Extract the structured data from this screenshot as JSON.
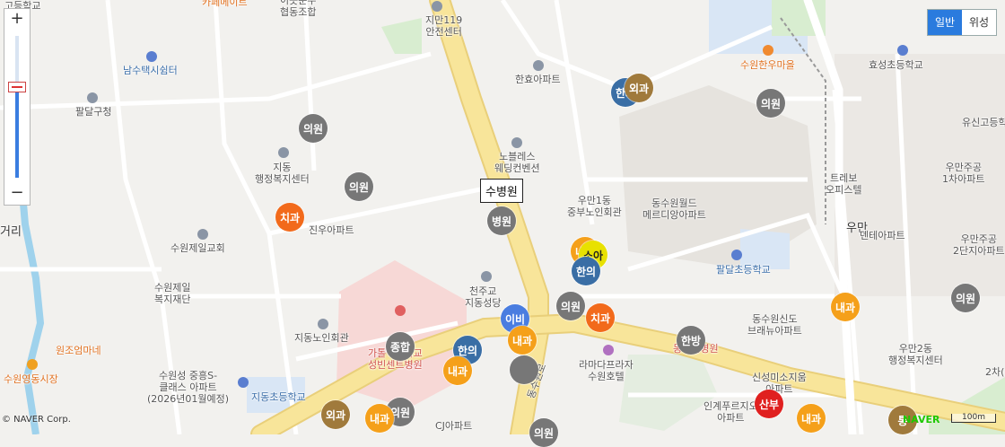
{
  "map_type": {
    "normal": "일반",
    "satellite": "위성",
    "selected": "일반"
  },
  "zoom": {
    "in": "+",
    "out": "−",
    "level_fraction": 0.64
  },
  "tooltip": "수병원",
  "copyright": "© NAVER Corp.",
  "brand": "NAVER",
  "scale_label": "100m",
  "place_labels": [
    {
      "text": "고등학교",
      "style": "normal"
    },
    {
      "text": "카페메이트",
      "style": "orange"
    },
    {
      "text": "이곳운수\n협동조합",
      "style": "normal"
    },
    {
      "text": "지만119\n안전센터",
      "style": "normal"
    },
    {
      "text": "남수택시쉼터",
      "style": "blue"
    },
    {
      "text": "팔달구청",
      "style": "normal"
    },
    {
      "text": "한효아파트",
      "style": "normal"
    },
    {
      "text": "수원한우마을",
      "style": "orange"
    },
    {
      "text": "효성초등학교",
      "style": "normal"
    },
    {
      "text": "유신고등학",
      "style": "normal"
    },
    {
      "text": "노블레스\n웨딩컨벤션",
      "style": "normal"
    },
    {
      "text": "지동\n행정복지센터",
      "style": "normal"
    },
    {
      "text": "우만1동\n중부노인회관",
      "style": "normal"
    },
    {
      "text": "동수원월드\n메르디앙아파트",
      "style": "normal"
    },
    {
      "text": "트레보\n오피스텔",
      "style": "normal"
    },
    {
      "text": "우만주공\n1차아파트",
      "style": "normal"
    },
    {
      "text": "진우아파트",
      "style": "normal"
    },
    {
      "text": "수원제일교회",
      "style": "normal"
    },
    {
      "text": "거리",
      "style": "big"
    },
    {
      "text": "우만",
      "style": "big"
    },
    {
      "text": "덴테아파트",
      "style": "normal"
    },
    {
      "text": "우만주공\n2단지아파트",
      "style": "normal"
    },
    {
      "text": "수원제일\n복지재단",
      "style": "normal"
    },
    {
      "text": "팔달초등학교",
      "style": "blue"
    },
    {
      "text": "천주교\n지동성당",
      "style": "normal"
    },
    {
      "text": "지동노인회관",
      "style": "normal"
    },
    {
      "text": "동수원신도\n브래뉴아파트",
      "style": "normal"
    },
    {
      "text": "가톨릭대학교\n성빈센트병원",
      "style": "red"
    },
    {
      "text": "원조엄마네",
      "style": "orange"
    },
    {
      "text": "수원영동시장",
      "style": "orange"
    },
    {
      "text": "수원성 중흥S-\n클래스 아파트\n(2026년01월예정)",
      "style": "normal"
    },
    {
      "text": "지동초등학교",
      "style": "blue"
    },
    {
      "text": "라마다프라자\n수원호텔",
      "style": "normal"
    },
    {
      "text": "동수원병원",
      "style": "red"
    },
    {
      "text": "신성미소지움\n아파트",
      "style": "normal"
    },
    {
      "text": "우만2동\n행정복지센터",
      "style": "normal"
    },
    {
      "text": "인계푸르지오\n아파트",
      "style": "normal"
    },
    {
      "text": "CJ아파트",
      "style": "normal"
    },
    {
      "text": "2차(",
      "style": "normal"
    },
    {
      "text": "동수원로",
      "style": "normal"
    }
  ],
  "markers": [
    {
      "label": "의원",
      "color": "#777777"
    },
    {
      "label": "의원",
      "color": "#777777"
    },
    {
      "label": "의원",
      "color": "#777777"
    },
    {
      "label": "치과",
      "color": "#f26a1b"
    },
    {
      "label": "병원",
      "color": "#777777"
    },
    {
      "label": "한의",
      "color": "#3a6ea5"
    },
    {
      "label": "외과",
      "color": "#a07a3c"
    },
    {
      "label": "의원",
      "color": "#777777"
    },
    {
      "label": "내과",
      "color": "#f5a01a"
    },
    {
      "label": "소아",
      "color": "#e8e100"
    },
    {
      "label": "한의",
      "color": "#3a6ea5"
    },
    {
      "label": "의원",
      "color": "#777777"
    },
    {
      "label": "치과",
      "color": "#f26a1b"
    },
    {
      "label": "이비",
      "color": "#4a7de0"
    },
    {
      "label": "내과",
      "color": "#f5a01a"
    },
    {
      "label": "종합",
      "color": "#777777"
    },
    {
      "label": "한의",
      "color": "#3a6ea5"
    },
    {
      "label": "내과",
      "color": "#f5a01a"
    },
    {
      "label": "",
      "color": "#777777"
    },
    {
      "label": "한방",
      "color": "#777777"
    },
    {
      "label": "내과",
      "color": "#f5a01a"
    },
    {
      "label": "의원",
      "color": "#777777"
    },
    {
      "label": "외과",
      "color": "#a07a3c"
    },
    {
      "label": "내과",
      "color": "#f5a01a"
    },
    {
      "label": "의원",
      "color": "#777777"
    },
    {
      "label": "산부",
      "color": "#e0201f"
    },
    {
      "label": "내과",
      "color": "#f5a01a"
    },
    {
      "label": "통",
      "color": "#a07a3c"
    }
  ]
}
